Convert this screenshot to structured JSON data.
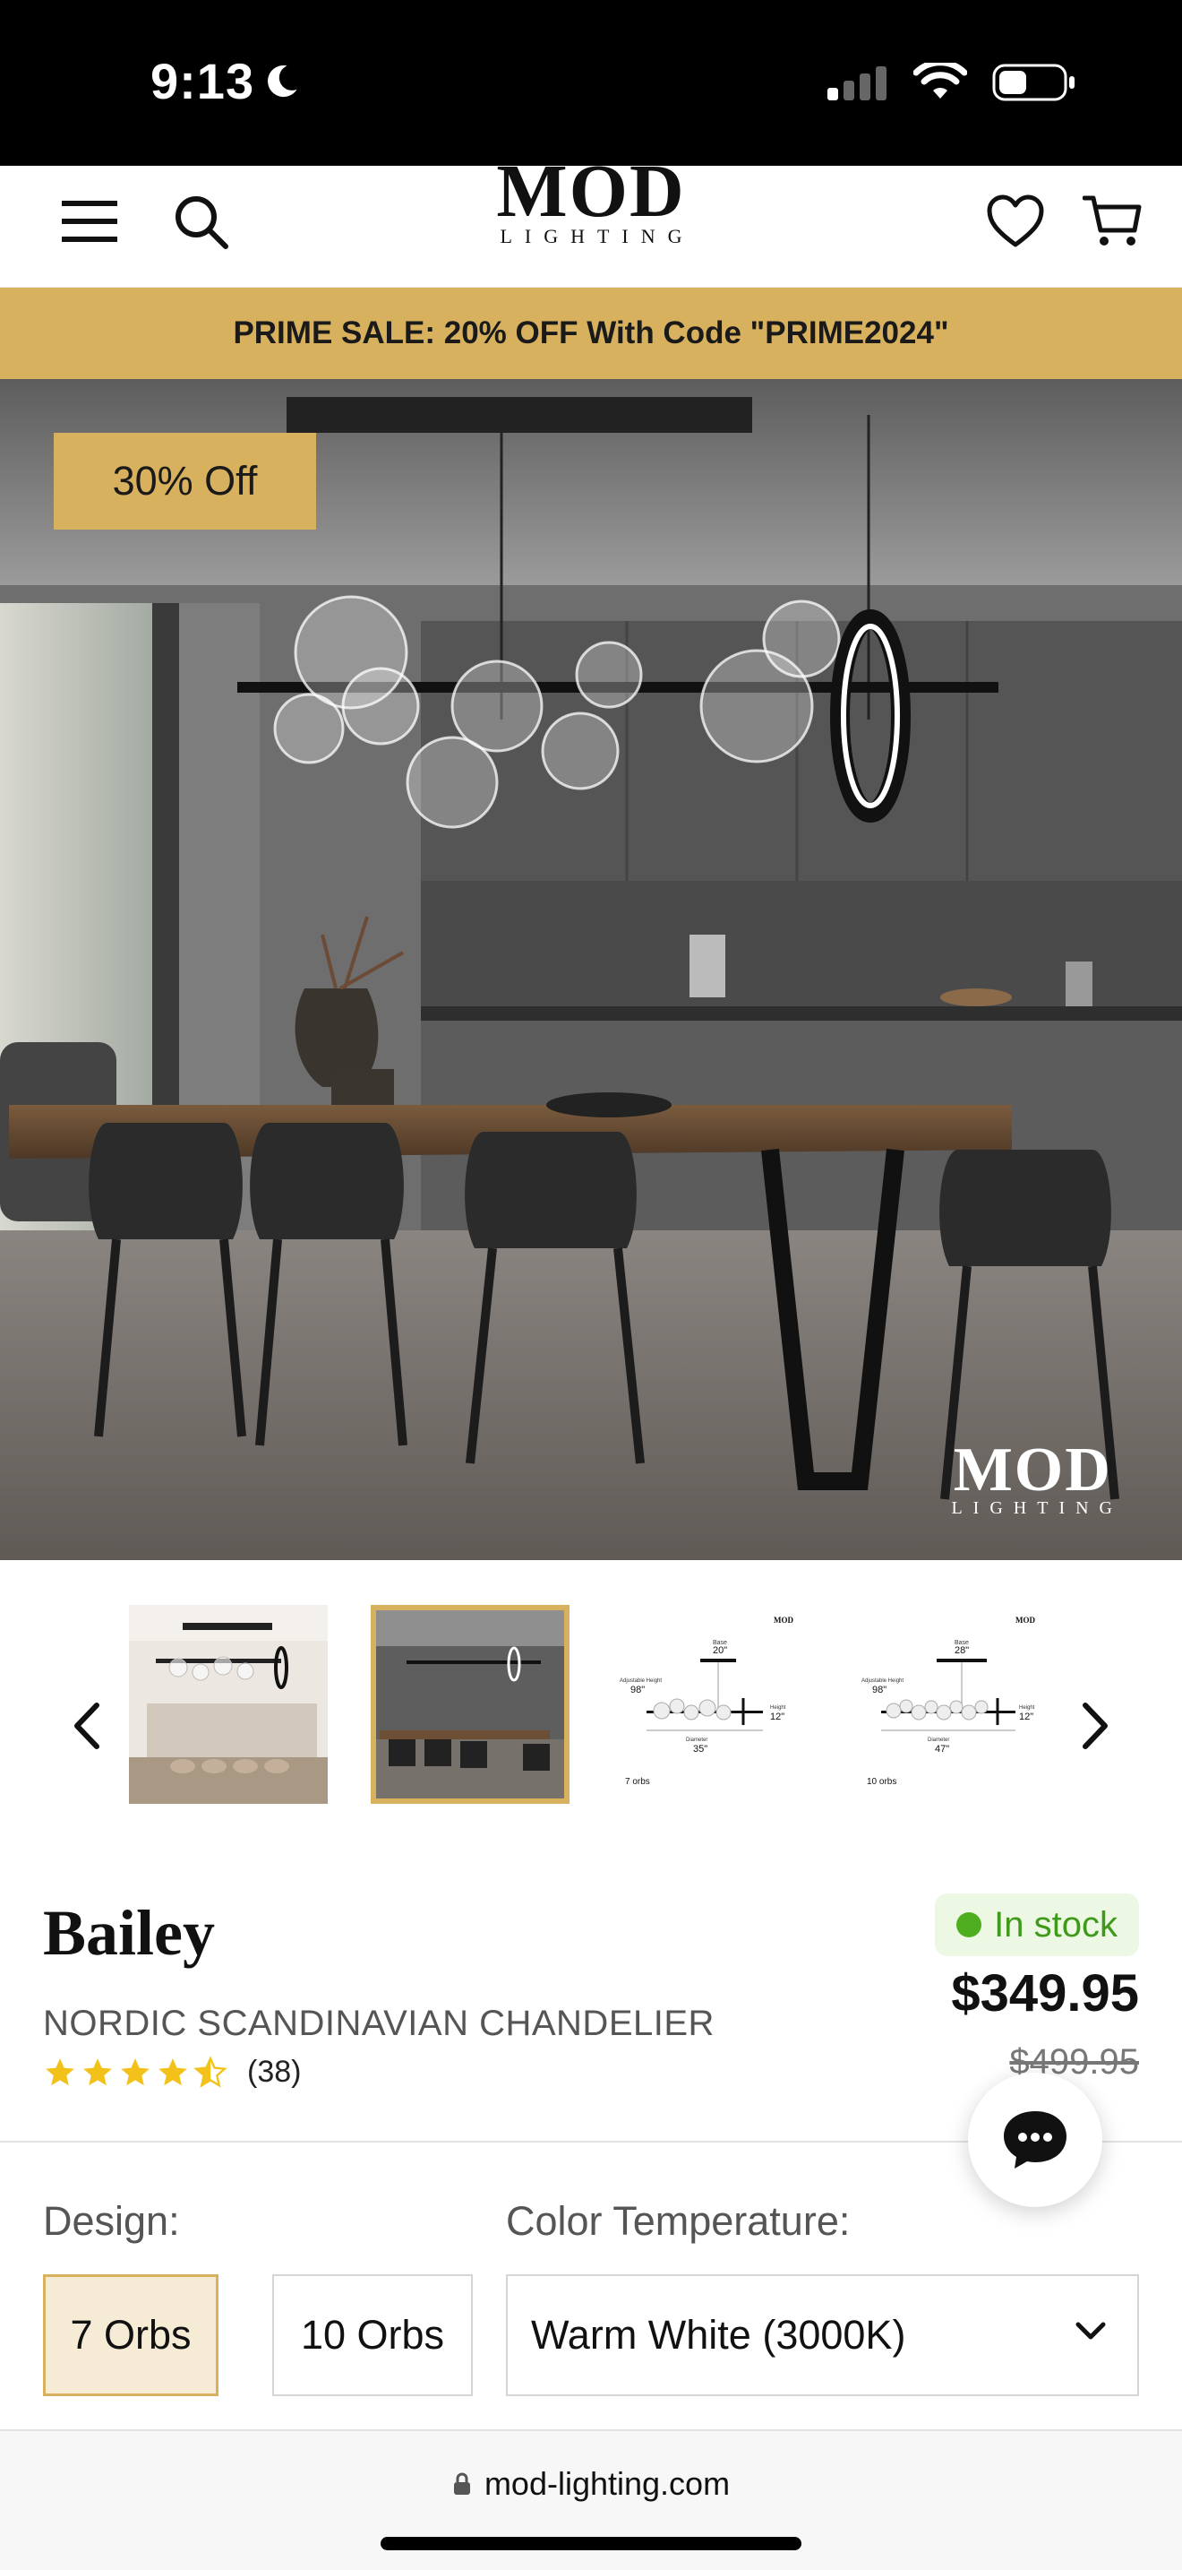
{
  "status_bar": {
    "time": "9:13"
  },
  "header": {
    "logo_main": "MOD",
    "logo_sub": "LIGHTING",
    "icons": [
      "menu-icon",
      "search-icon",
      "heart-icon",
      "cart-icon"
    ]
  },
  "promo": {
    "text": "PRIME SALE: 20% OFF With Code \"PRIME2024\""
  },
  "hero": {
    "badge": "30% Off",
    "watermark_main": "MOD",
    "watermark_sub": "LIGHTING"
  },
  "thumbnails": {
    "items": [
      {
        "kind": "photo-kitchen"
      },
      {
        "kind": "photo-dining",
        "active": true
      },
      {
        "kind": "diagram",
        "caption": "7 orbs",
        "brand": "MOD",
        "base": "20\"",
        "height": "98\"",
        "drop": "12\"",
        "diameter": "35\"",
        "label_base": "Base",
        "label_height": "Adjustable Height",
        "label_drop": "Height",
        "label_diameter": "Diameter"
      },
      {
        "kind": "diagram",
        "caption": "10 orbs",
        "brand": "MOD",
        "base": "28\"",
        "height": "98\"",
        "drop": "12\"",
        "diameter": "47\"",
        "label_base": "Base",
        "label_height": "Adjustable Height",
        "label_drop": "Height",
        "label_diameter": "Diameter"
      }
    ]
  },
  "product": {
    "title": "Bailey",
    "subtitle": "NORDIC SCANDINAVIAN CHANDELIER",
    "rating": 4.5,
    "review_count": "(38)",
    "stock": "In stock",
    "price": "$349.95",
    "old_price": "$499.95"
  },
  "options": {
    "design_label": "Design:",
    "design_options": [
      {
        "label": "7 Orbs",
        "selected": true
      },
      {
        "label": "10 Orbs",
        "selected": false
      }
    ],
    "color_temp_label": "Color Temperature:",
    "color_temp_value": "Warm White (3000K)"
  },
  "browser": {
    "url": "mod-lighting.com"
  },
  "colors": {
    "accent_gold": "#d8b15e",
    "stock_green": "#4fae1f",
    "star_yellow": "#f2c21b"
  }
}
